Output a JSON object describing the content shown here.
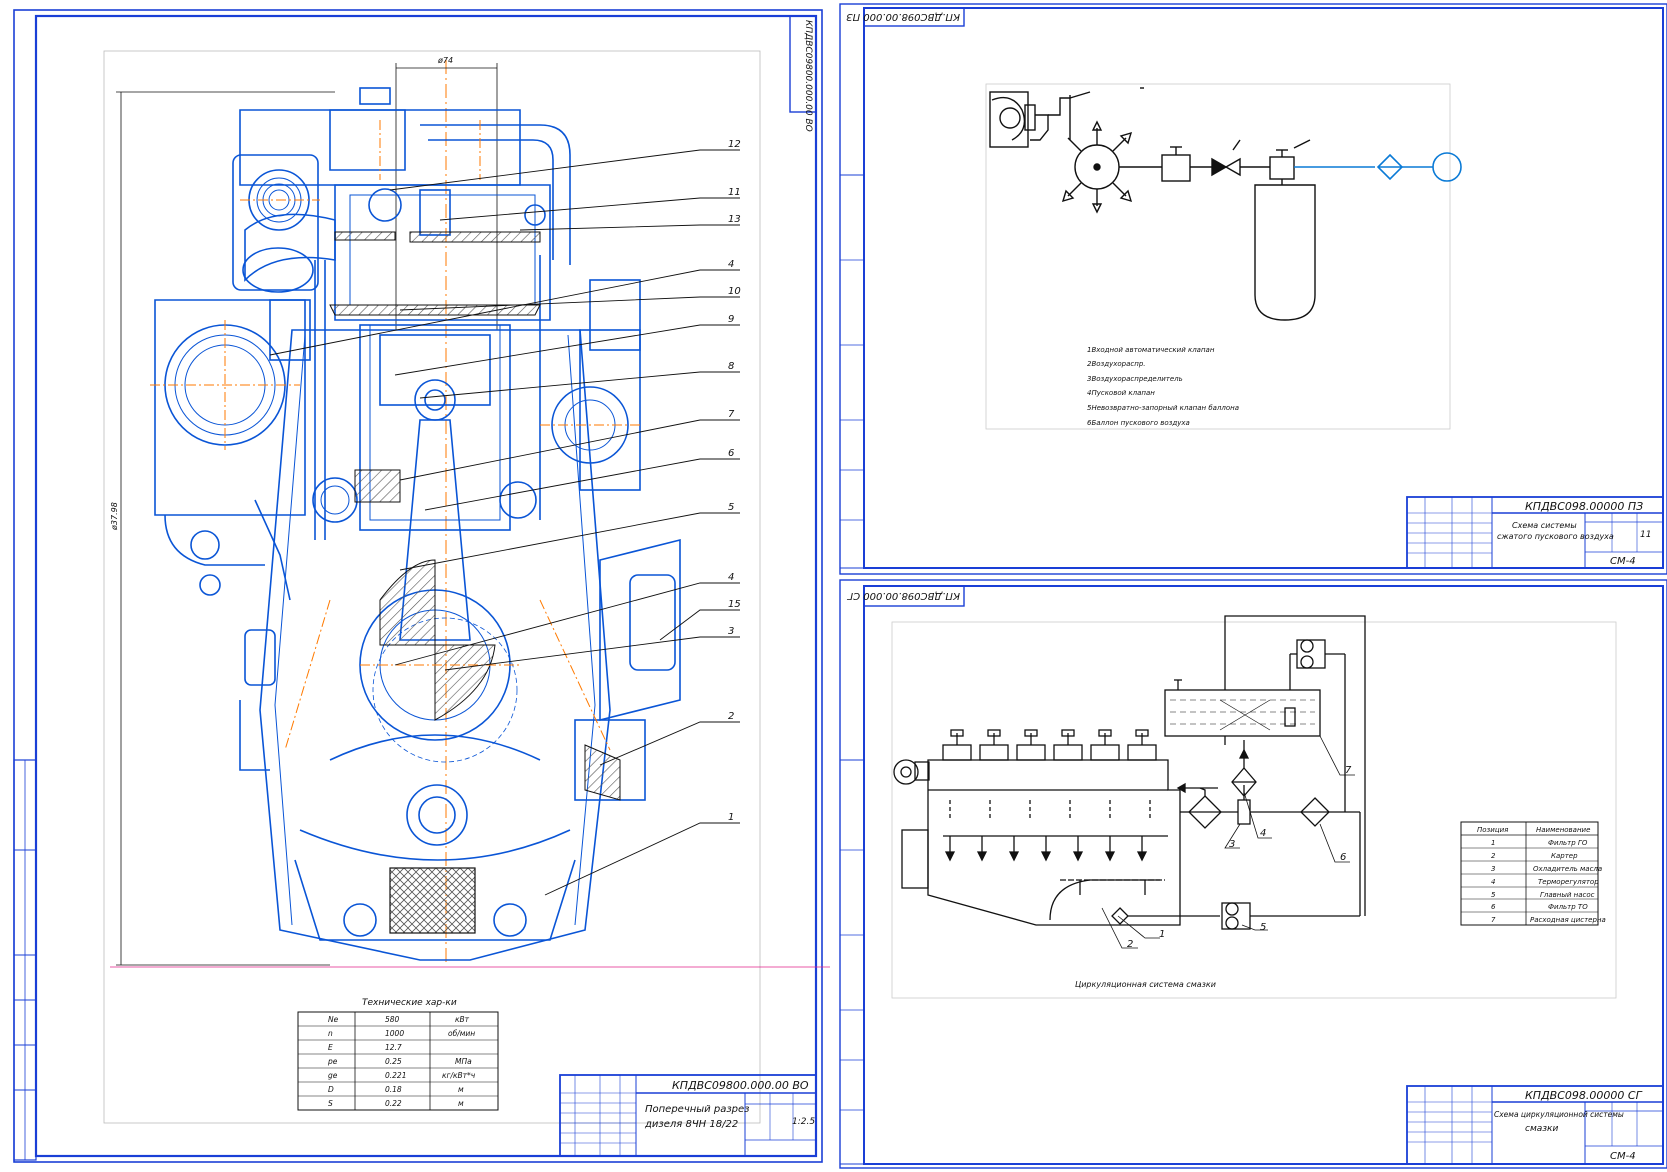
{
  "sheet1": {
    "doc_code": "КПДВС09800.000.00 ВО",
    "rot_code": "КПДВС09800.000.00 ВО",
    "title_line1": "Поперечный разрез",
    "title_line2": "дизеля 8ЧН 18/22",
    "scale": "1:2.5",
    "dim_top": "ø74",
    "dim_left": "ø37.98",
    "leaders": [
      "12",
      "11",
      "13",
      "4",
      "10",
      "9",
      "8",
      "7",
      "6",
      "5",
      "4",
      "15",
      "3",
      "2",
      "1"
    ],
    "tech_title": "Технические хар-ки",
    "tech_rows": [
      [
        "Ne",
        "580",
        "кВт"
      ],
      [
        "n",
        "1000",
        "об/мин"
      ],
      [
        "E",
        "12.7",
        ""
      ],
      [
        "pe",
        "0.25",
        "МПа"
      ],
      [
        "ge",
        "0.221",
        "кг/кВт*ч"
      ],
      [
        "D",
        "0.18",
        "м"
      ],
      [
        "S",
        "0.22",
        "м"
      ]
    ]
  },
  "sheet2": {
    "doc_code": "КПДВС098.00000 ПЗ",
    "rot_code": "КП.ДВС098.00.000 ПЗ",
    "title_line1": "Схема системы",
    "title_line2": "сжатого пускового воздуха",
    "sheet_no": "11",
    "group": "СМ-4",
    "notes": [
      "1Входной автоматический клапан",
      "2Воздухораспр.",
      "3Воздухораспределитель",
      "4Пусковой клапан",
      "5Невозвратно-запорный клапан баллона",
      "6Баллон пускового воздуха"
    ]
  },
  "sheet3": {
    "doc_code": "КПДВС098.00000 СГ",
    "rot_code": "КП.ДВС098.00.000 СГ",
    "title_line1": "Схема циркуляционной системы",
    "title_line2": "смазки",
    "group": "СМ-4",
    "caption": "Циркуляционная система смазки",
    "legend_header": [
      "Позиция",
      "Наименование"
    ],
    "legend_rows": [
      [
        "1",
        "Фильтр ГО"
      ],
      [
        "2",
        "Картер"
      ],
      [
        "3",
        "Охладитель масла"
      ],
      [
        "4",
        "Терморегулятор"
      ],
      [
        "5",
        "Главный насос"
      ],
      [
        "6",
        "Фильтр ТО"
      ],
      [
        "7",
        "Расходная цистерна"
      ]
    ],
    "callouts": [
      "1",
      "2",
      "3",
      "4",
      "5",
      "6",
      "7"
    ]
  },
  "colors": {
    "outline": "#0a55d6",
    "line": "#111111",
    "frame": "#1a3fd6",
    "axis": "#ff7a00",
    "hatch": "#555555"
  }
}
